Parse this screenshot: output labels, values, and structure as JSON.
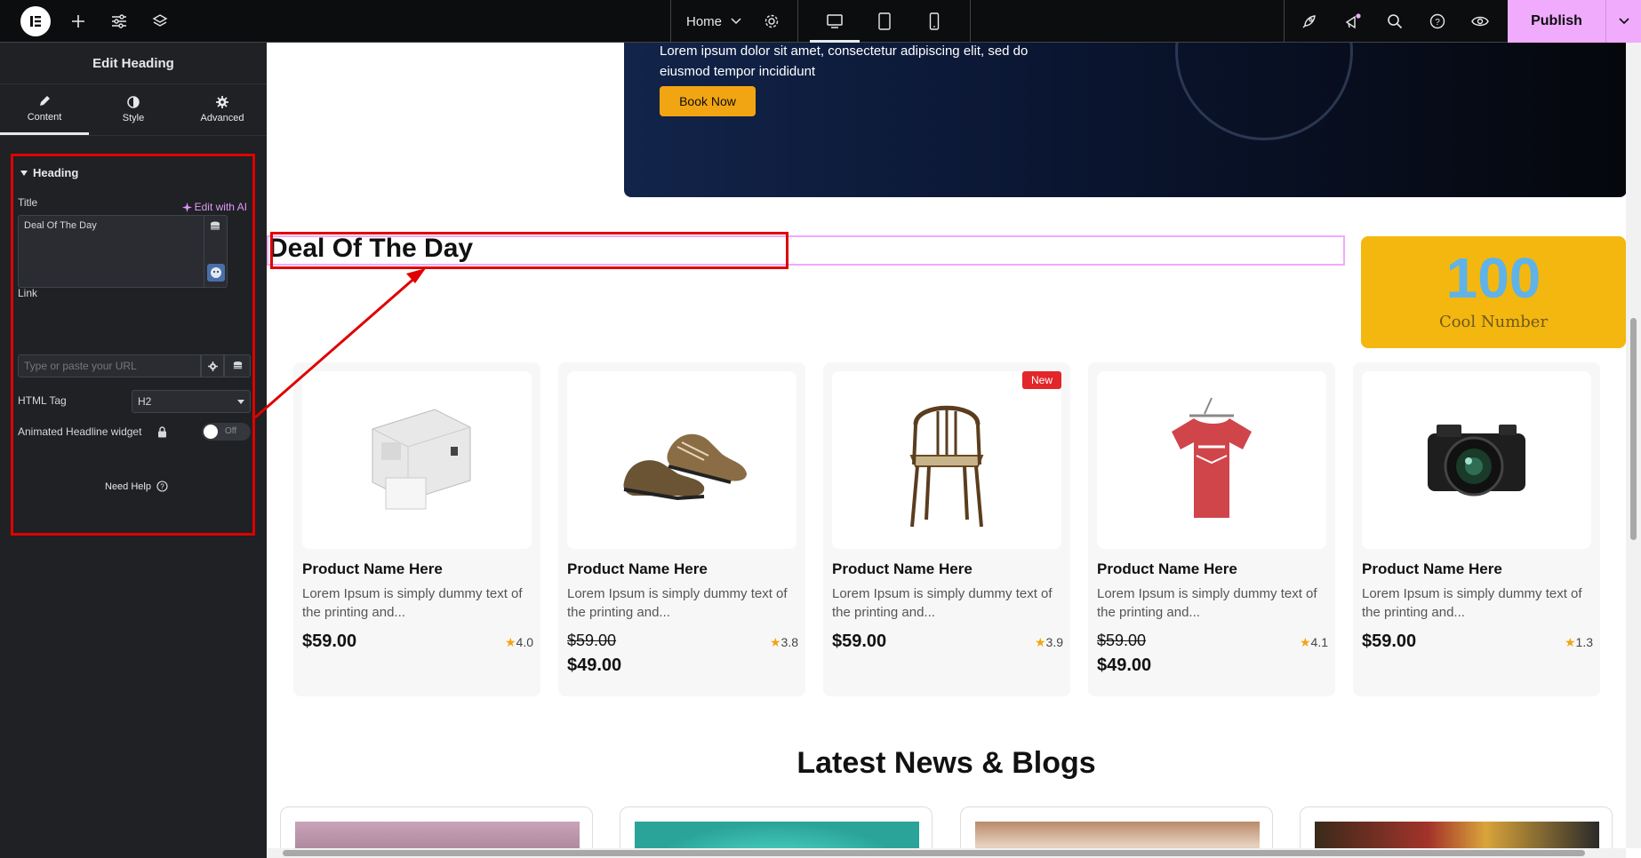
{
  "topbar": {
    "page_name": "Home",
    "publish_label": "Publish",
    "icons": [
      "elementor-logo-icon",
      "plus-icon",
      "sliders-icon",
      "layers-icon",
      "chevron-down-icon",
      "gear-icon",
      "desktop-icon",
      "tablet-icon",
      "mobile-icon",
      "rocket-icon",
      "megaphone-icon",
      "search-icon",
      "help-icon",
      "eye-icon",
      "chevron-down-icon"
    ]
  },
  "panel": {
    "title": "Edit Heading",
    "tabs": [
      {
        "label": "Content",
        "icon": "pencil-icon",
        "active": true
      },
      {
        "label": "Style",
        "icon": "half-circle-icon",
        "active": false
      },
      {
        "label": "Advanced",
        "icon": "gear-icon",
        "active": false
      }
    ],
    "section_title": "Heading",
    "title_label": "Title",
    "edit_ai_label": "Edit with AI",
    "title_value": "Deal Of The Day",
    "link_label": "Link",
    "link_placeholder": "Type or paste your URL",
    "html_tag_label": "HTML Tag",
    "html_tag_value": "H2",
    "animated_label": "Animated Headline widget",
    "toggle_label": "Off",
    "need_help_label": "Need Help"
  },
  "canvas": {
    "hero_text": "Lorem ipsum dolor sit amet, consectetur adipiscing elit, sed do eiusmod tempor incididunt",
    "hero_button": "Book Now",
    "heading": "Deal Of The Day",
    "counter": {
      "number": "100",
      "caption": "Cool Number",
      "number_color": "#5fb3e8",
      "bg_color": "#f4b70f"
    },
    "products": [
      {
        "name": "Product Name Here",
        "desc": "Lorem Ipsum is simply dummy text of the printing and...",
        "price": "$59.00",
        "sale_price": "",
        "rating": "4.0",
        "badge": "",
        "image": "printer"
      },
      {
        "name": "Product Name Here",
        "desc": "Lorem Ipsum is simply dummy text of the printing and...",
        "price": "$59.00",
        "sale_price": "$49.00",
        "rating": "3.8",
        "badge": "",
        "image": "shoes"
      },
      {
        "name": "Product Name Here",
        "desc": "Lorem Ipsum is simply dummy text of the printing and...",
        "price": "$59.00",
        "sale_price": "",
        "rating": "3.9",
        "badge": "New",
        "image": "chair"
      },
      {
        "name": "Product Name Here",
        "desc": "Lorem Ipsum is simply dummy text of the printing and...",
        "price": "$59.00",
        "sale_price": "$49.00",
        "rating": "4.1",
        "badge": "",
        "image": "tshirt"
      },
      {
        "name": "Product Name Here",
        "desc": "Lorem Ipsum is simply dummy text of the printing and...",
        "price": "$59.00",
        "sale_price": "",
        "rating": "1.3",
        "badge": "",
        "image": "camera"
      }
    ],
    "blogs_title": "Latest News & Blogs"
  },
  "colors": {
    "accent": "#f0abfc",
    "panel_bg": "#1f2124",
    "annotation_red": "#e00000",
    "star": "#f2a512"
  }
}
